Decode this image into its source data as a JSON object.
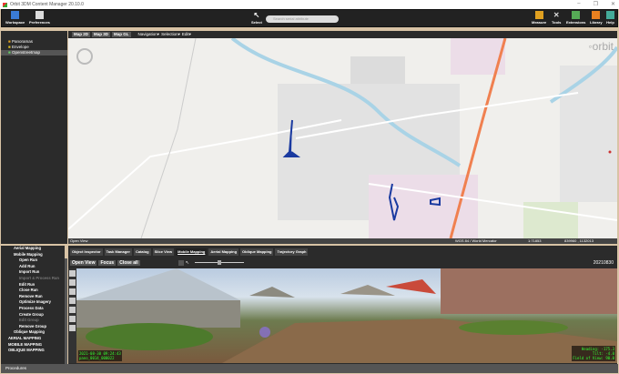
{
  "window": {
    "title": "Orbit 3DM Content Manager 20.10.0",
    "controls": [
      "–",
      "❐",
      "✕"
    ]
  },
  "toolbar": {
    "left": [
      {
        "label": "Workspace",
        "color": "#3a7bd5"
      },
      {
        "label": "Preferences",
        "color": "#ddd"
      }
    ],
    "select": "Select",
    "search_placeholder": "Search serial attribute",
    "right": [
      {
        "label": "Measure",
        "color": "#e0a020"
      },
      {
        "label": "Tools",
        "color": "#ddd"
      },
      {
        "label": "Extensions",
        "color": "#5a5"
      },
      {
        "label": "Library",
        "color": "#e88020"
      },
      {
        "label": "Help",
        "color": "#4a9"
      }
    ]
  },
  "layers": [
    {
      "label": "Panoramas",
      "color": "#e0a020"
    },
    {
      "label": "Envelope",
      "color": "#e0c020"
    },
    {
      "label": "Openstreetmap",
      "color": "#6c6"
    }
  ],
  "map": {
    "views": [
      "Map 2D",
      "Map 3D",
      "Map GL"
    ],
    "menus": [
      "Navigation▾",
      "Selection▾",
      "Edit▾"
    ],
    "brand": "orbit",
    "open_view": "Open View",
    "crs": "WGS 84 / World Mercator",
    "scale": "1:71853",
    "coords": "839960 , 1132013",
    "marker_color": "#1a3aa0",
    "road_color": "#f08050"
  },
  "mapping_tree": [
    {
      "label": "Aerial Mapping",
      "level": 1,
      "muted": false
    },
    {
      "label": "Mobile Mapping",
      "level": 1,
      "muted": false
    },
    {
      "label": "Open Run",
      "level": 2,
      "muted": false
    },
    {
      "label": "Add Run",
      "level": 2,
      "muted": false
    },
    {
      "label": "Import Run",
      "level": 2,
      "muted": false
    },
    {
      "label": "Import & Process Run",
      "level": 2,
      "muted": true
    },
    {
      "label": "Edit Run",
      "level": 2,
      "muted": false
    },
    {
      "label": "Close Run",
      "level": 2,
      "muted": false
    },
    {
      "label": "Remove Run",
      "level": 2,
      "muted": false
    },
    {
      "label": "Optimize Imagery",
      "level": 2,
      "muted": false
    },
    {
      "label": "Process Data",
      "level": 2,
      "muted": false
    },
    {
      "label": "Create Group",
      "level": 2,
      "muted": false
    },
    {
      "label": "Edit Group",
      "level": 2,
      "muted": true
    },
    {
      "label": "Remove Group",
      "level": 2,
      "muted": false
    },
    {
      "label": "Oblique Mapping",
      "level": 1,
      "muted": false
    },
    {
      "label": "AERIAL MAPPING",
      "level": 0,
      "muted": false
    },
    {
      "label": "MOBILE MAPPING",
      "level": 0,
      "muted": false
    },
    {
      "label": "OBLIQUE MAPPING",
      "level": 0,
      "muted": false
    }
  ],
  "tabs": [
    {
      "label": "Object Inspector",
      "active": false
    },
    {
      "label": "Task Manager",
      "active": false
    },
    {
      "label": "Catalog",
      "active": false
    },
    {
      "label": "Slice View",
      "active": false
    },
    {
      "label": "Mobile Mapping",
      "active": true
    },
    {
      "label": "Aerial Mapping",
      "active": false
    },
    {
      "label": "Oblique Mapping",
      "active": false
    },
    {
      "label": "Trajectory Graph",
      "active": false
    }
  ],
  "viewer": {
    "buttons": [
      "Open View",
      "Focus",
      "Close all"
    ],
    "date": "20210830",
    "slider_value": 0.5,
    "timestamp": "2021-08-30 09:24:43",
    "pano": "pano_0014_000022",
    "heading": "Heading: -175.3",
    "tilt": "Tilt: -4.0",
    "fov": "Field of View: 90.0"
  },
  "statusbar": {
    "label": "Procedures"
  }
}
